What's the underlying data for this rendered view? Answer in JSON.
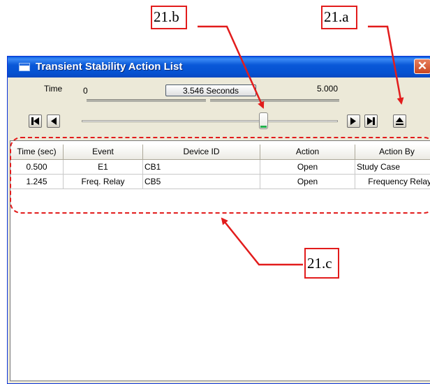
{
  "callouts": {
    "a": "21.a",
    "b": "21.b",
    "c": "21.c"
  },
  "window": {
    "title": "Transient Stability Action List",
    "close_glyph": "✕"
  },
  "time": {
    "label": "Time",
    "start": "0",
    "current": "3.546 Seconds",
    "end": "5.000",
    "slider_fraction": 0.709
  },
  "buttons": [
    {
      "name": "first-frame",
      "icon": "skip-to-start-icon"
    },
    {
      "name": "step-back",
      "icon": "step-back-icon"
    },
    {
      "name": "step-forward",
      "icon": "step-forward-icon"
    },
    {
      "name": "last-frame",
      "icon": "skip-to-end-icon"
    },
    {
      "name": "eject",
      "icon": "eject-icon"
    }
  ],
  "table": {
    "columns": [
      "Time (sec)",
      "Event",
      "Device ID",
      "Action",
      "Action By"
    ],
    "rows": [
      [
        "0.500",
        "E1",
        "CB1",
        "Open",
        "Study Case"
      ],
      [
        "1.245",
        "Freq. Relay",
        "CB5",
        "Open",
        "Frequency Relay"
      ]
    ]
  },
  "colors": {
    "annotation": "#e21c1c",
    "titlebar": "#0a58d8",
    "slider_fill": "#22b14c"
  }
}
